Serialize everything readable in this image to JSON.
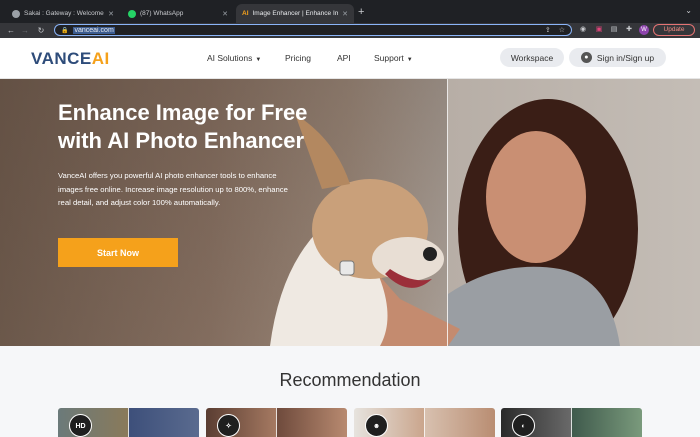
{
  "browser": {
    "tabs": [
      {
        "title": "Sakai : Gateway : Welcome"
      },
      {
        "title": "(87) WhatsApp"
      },
      {
        "title": "Image Enhancer | Enhance Image"
      }
    ],
    "new_tab": "+",
    "url": "vanceai.com",
    "profile_initial": "W",
    "update_label": "Update"
  },
  "site": {
    "logo_main": "VANCE",
    "logo_ai": "AI",
    "nav": {
      "ai_solutions": "AI Solutions",
      "pricing": "Pricing",
      "api": "API",
      "support": "Support"
    },
    "workspace_label": "Workspace",
    "signin_label": "Sign in/Sign up"
  },
  "hero": {
    "title_line1": "Enhance Image for Free",
    "title_line2": "with AI Photo Enhancer",
    "description": "VanceAI offers you powerful AI photo enhancer tools to enhance images free online. Increase image resolution up to 800%, enhance real detail, and adjust color 100% automatically.",
    "cta_label": "Start Now"
  },
  "recommendation": {
    "title": "Recommendation",
    "cards": [
      {
        "badge": "HD",
        "icon": "hd-icon"
      },
      {
        "badge": "",
        "icon": "sparkle-face-icon"
      },
      {
        "badge": "",
        "icon": "portrait-icon"
      },
      {
        "badge": "",
        "icon": "colorize-icon"
      }
    ]
  },
  "colors": {
    "accent": "#f5a11b",
    "logo_blue": "#2e4c7a"
  }
}
